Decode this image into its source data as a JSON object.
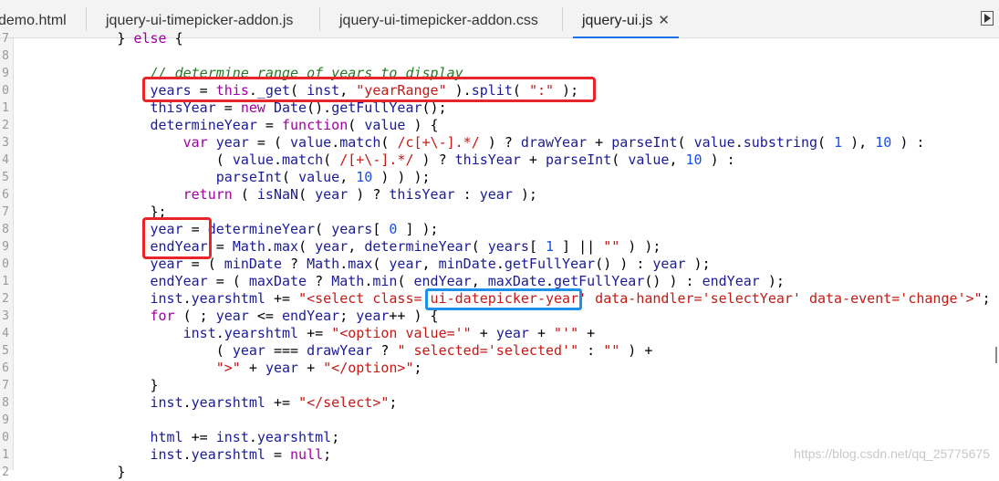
{
  "tabs": [
    {
      "label": "demo.html",
      "active": false
    },
    {
      "label": "jquery-ui-timepicker-addon.js",
      "active": false
    },
    {
      "label": "jquery-ui-timepicker-addon.css",
      "active": false
    },
    {
      "label": "jquery-ui.js",
      "active": true
    }
  ],
  "close_glyph": "✕",
  "editor": {
    "lines": [
      {
        "n": "7",
        "text": "            } else {"
      },
      {
        "n": "8",
        "text": ""
      },
      {
        "n": "9",
        "text": "                // determine range of years to display"
      },
      {
        "n": "0",
        "text": "                years = this._get( inst, \"yearRange\" ).split( \":\" );"
      },
      {
        "n": "1",
        "text": "                thisYear = new Date().getFullYear();"
      },
      {
        "n": "2",
        "text": "                determineYear = function( value ) {"
      },
      {
        "n": "3",
        "text": "                    var year = ( value.match( /c[+\\-].*/ ) ? drawYear + parseInt( value.substring( 1 ), 10 ) :"
      },
      {
        "n": "4",
        "text": "                        ( value.match( /[+\\-].*/ ) ? thisYear + parseInt( value, 10 ) :"
      },
      {
        "n": "5",
        "text": "                        parseInt( value, 10 ) ) );"
      },
      {
        "n": "6",
        "text": "                    return ( isNaN( year ) ? thisYear : year );"
      },
      {
        "n": "7",
        "text": "                };"
      },
      {
        "n": "8",
        "text": "                year = determineYear( years[ 0 ] );"
      },
      {
        "n": "9",
        "text": "                endYear = Math.max( year, determineYear( years[ 1 ] || \"\" ) );"
      },
      {
        "n": "0",
        "text": "                year = ( minDate ? Math.max( year, minDate.getFullYear() ) : year );"
      },
      {
        "n": "1",
        "text": "                endYear = ( maxDate ? Math.min( endYear, maxDate.getFullYear() ) : endYear );"
      },
      {
        "n": "2",
        "text": "                inst.yearshtml += \"<select class='ui-datepicker-year' data-handler='selectYear' data-event='change'>\";"
      },
      {
        "n": "3",
        "text": "                for ( ; year <= endYear; year++ ) {"
      },
      {
        "n": "4",
        "text": "                    inst.yearshtml += \"<option value='\" + year + \"'\" +"
      },
      {
        "n": "5",
        "text": "                        ( year === drawYear ? \" selected='selected'\" : \"\" ) +"
      },
      {
        "n": "6",
        "text": "                        \">\" + year + \"</option>\";"
      },
      {
        "n": "7",
        "text": "                }"
      },
      {
        "n": "8",
        "text": "                inst.yearshtml += \"</select>\";"
      },
      {
        "n": "9",
        "text": ""
      },
      {
        "n": "0",
        "text": "                html += inst.yearshtml;"
      },
      {
        "n": "1",
        "text": "                inst.yearshtml = null;"
      },
      {
        "n": "2",
        "text": "            }"
      }
    ]
  },
  "watermark": "https://blog.csdn.net/qq_25775675",
  "colors": {
    "highlight_red": "#e8262a",
    "highlight_blue": "#1e90e8",
    "active_tab_underline": "#1a73e8"
  }
}
